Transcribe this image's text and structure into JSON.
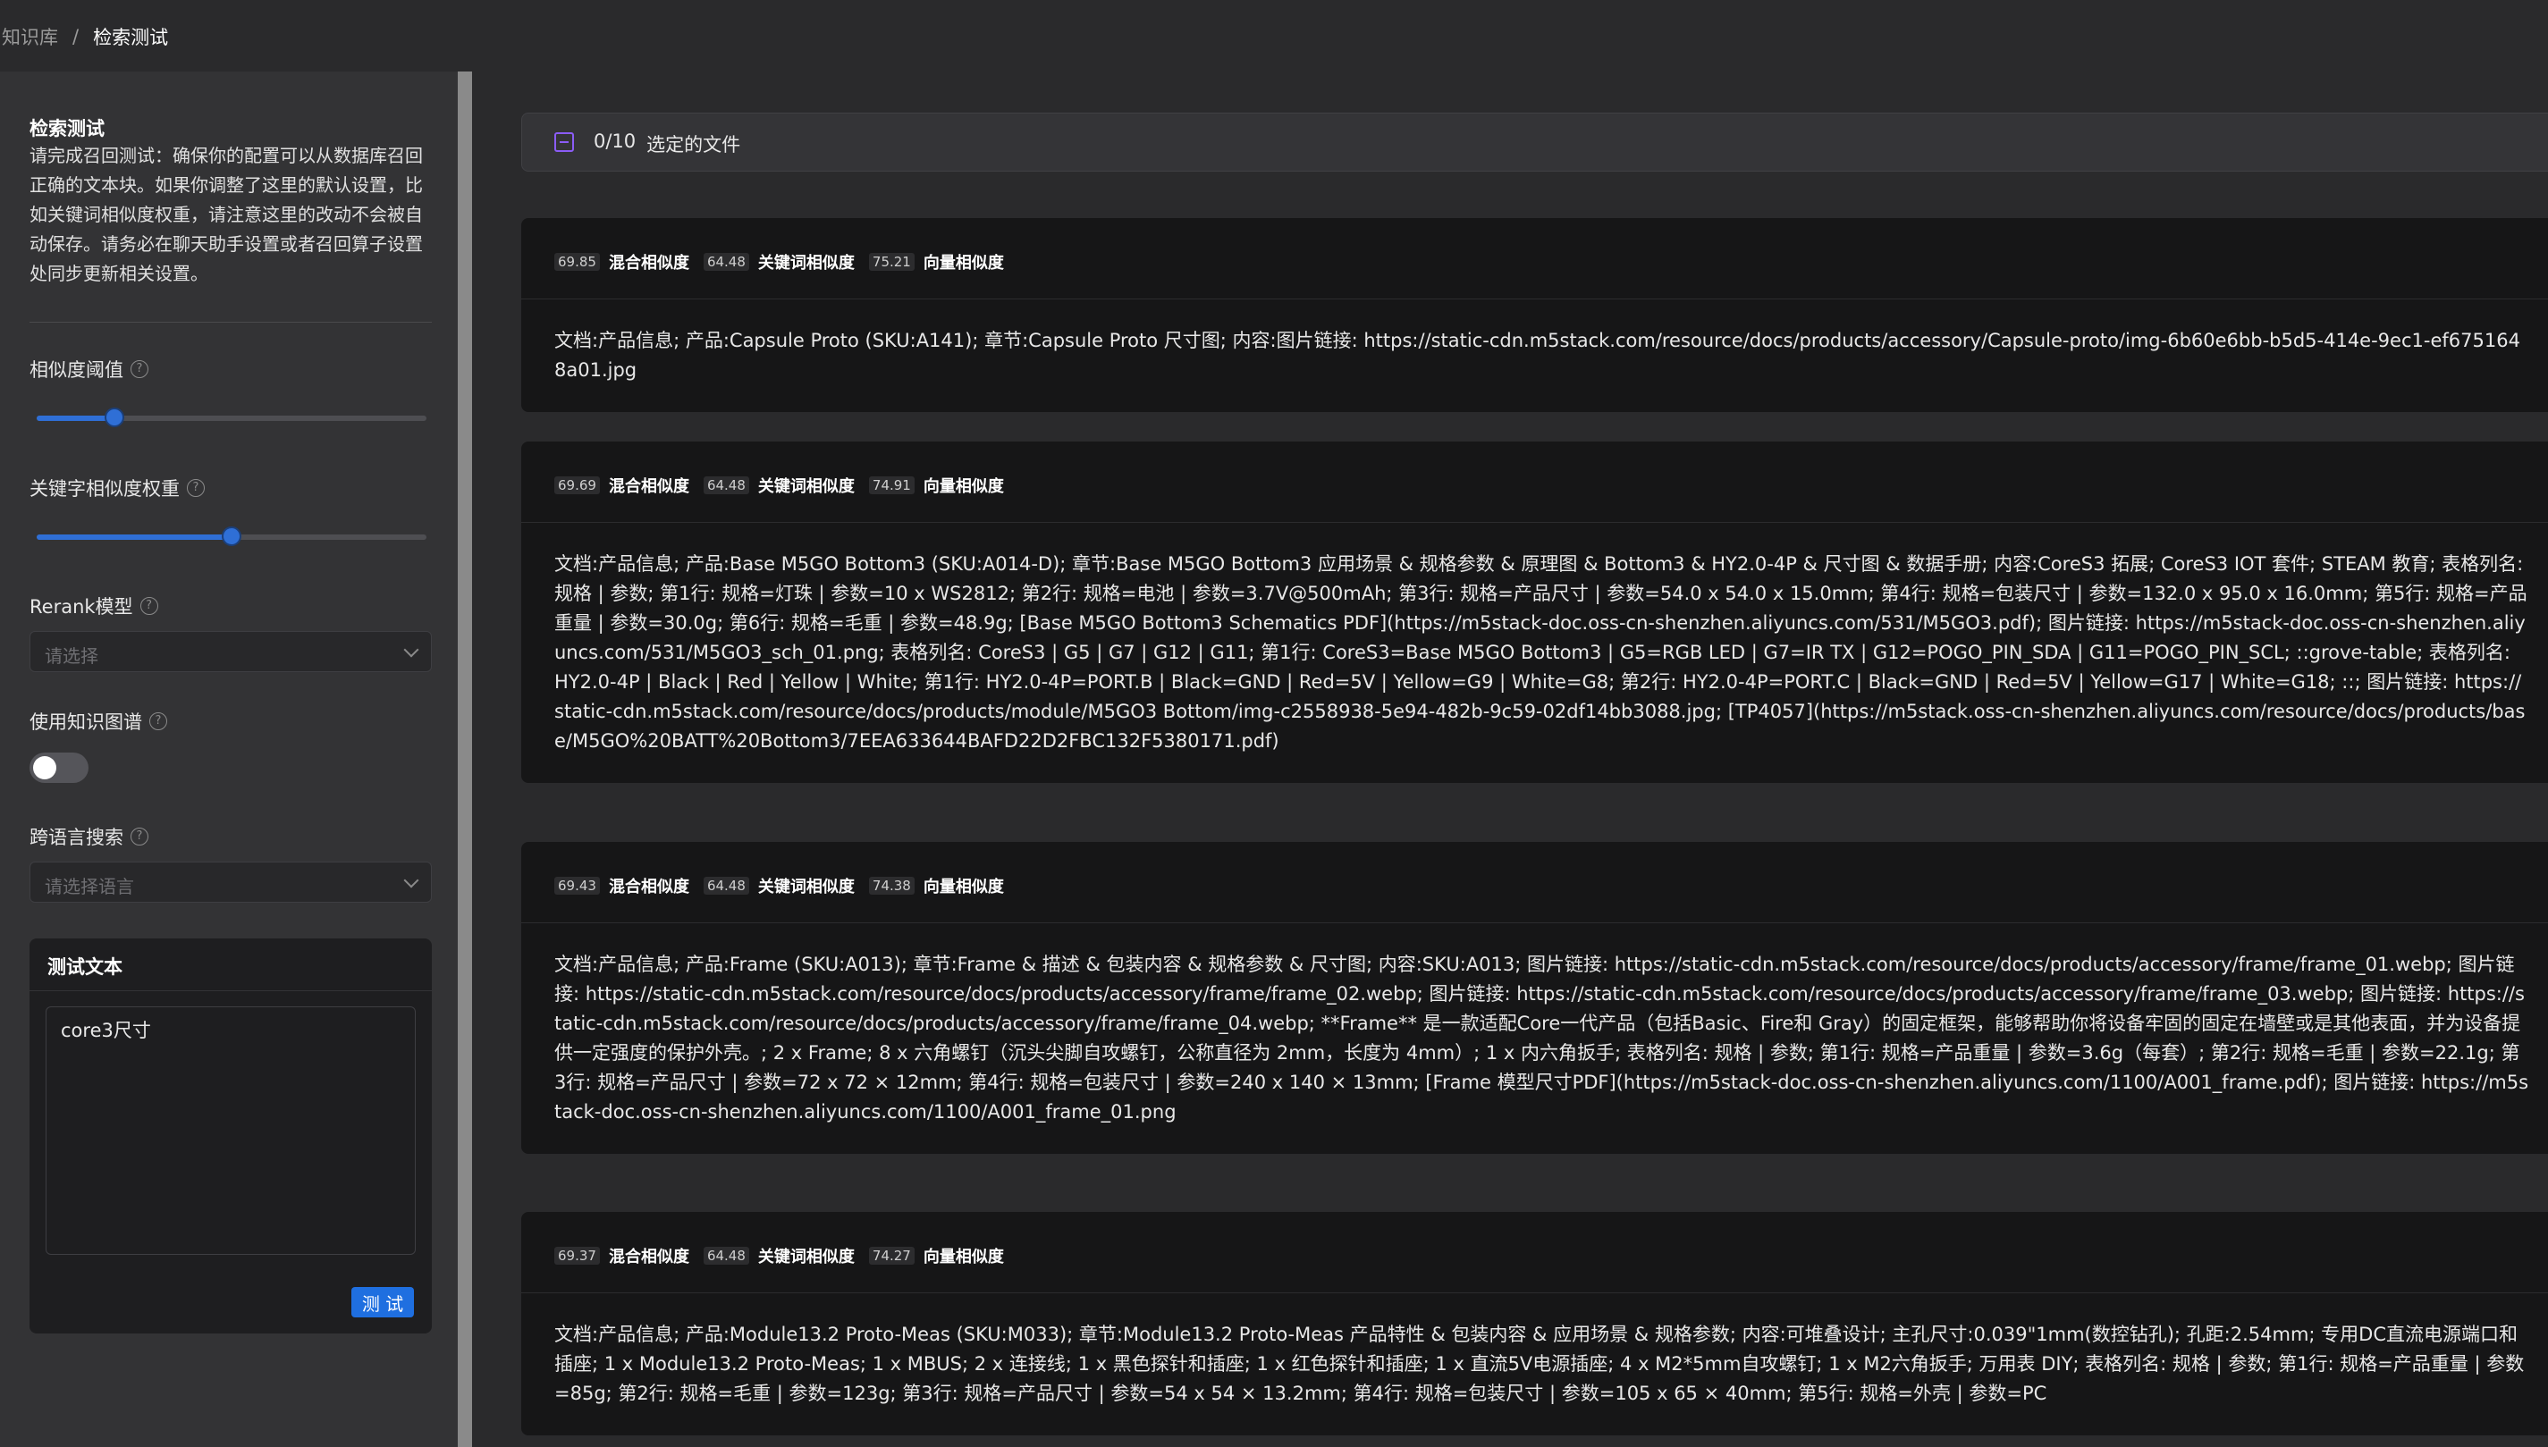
{
  "breadcrumb": {
    "root": "知识库",
    "separator": "/",
    "current": "检索测试"
  },
  "sidebar": {
    "title": "检索测试",
    "description": "请完成召回测试：确保你的配置可以从数据库召回正确的文本块。如果你调整了这里的默认设置，比如关键词相似度权重，请注意这里的改动不会被自动保存。请务必在聊天助手设置或者召回算子设置处同步更新相关设置。",
    "similarity_threshold": {
      "label": "相似度阈值",
      "value": 0.2
    },
    "keyword_weight": {
      "label": "关键字相似度权重",
      "value": 0.5
    },
    "rerank": {
      "label": "Rerank模型",
      "placeholder": "请选择"
    },
    "knowledge_graph": {
      "label": "使用知识图谱",
      "enabled": false
    },
    "cross_language": {
      "label": "跨语言搜索",
      "placeholder": "请选择语言"
    },
    "test_card": {
      "title": "测试文本",
      "input_value": "core3尺寸",
      "button_label": "测 试"
    }
  },
  "file_bar": {
    "count": "0/10",
    "label": "选定的文件"
  },
  "results": [
    {
      "hybrid": "69.85",
      "hybrid_label": "混合相似度",
      "keyword": "64.48",
      "keyword_label": "关键词相似度",
      "vector": "75.21",
      "vector_label": "向量相似度",
      "content": "文档:产品信息; 产品:Capsule Proto (SKU:A141); 章节:Capsule Proto 尺寸图; 内容:图片链接: https://static-cdn.m5stack.com/resource/docs/products/accessory/Capsule-proto/img-6b60e6bb-b5d5-414e-9ec1-ef6751648a01.jpg"
    },
    {
      "hybrid": "69.69",
      "hybrid_label": "混合相似度",
      "keyword": "64.48",
      "keyword_label": "关键词相似度",
      "vector": "74.91",
      "vector_label": "向量相似度",
      "content": "文档:产品信息; 产品:Base M5GO Bottom3 (SKU:A014-D); 章节:Base M5GO Bottom3 应用场景 & 规格参数 & 原理图 & Bottom3 & HY2.0-4P & 尺寸图 & 数据手册; 内容:CoreS3 拓展; CoreS3 IOT 套件; STEAM 教育; 表格列名: 规格 | 参数; 第1行: 规格=灯珠 | 参数=10 x WS2812; 第2行: 规格=电池 | 参数=3.7V@500mAh; 第3行: 规格=产品尺寸 | 参数=54.0 x 54.0 x 15.0mm; 第4行: 规格=包装尺寸 | 参数=132.0 x 95.0 x 16.0mm; 第5行: 规格=产品重量 | 参数=30.0g; 第6行: 规格=毛重 | 参数=48.9g; [Base M5GO Bottom3 Schematics PDF](https://m5stack-doc.oss-cn-shenzhen.aliyuncs.com/531/M5GO3.pdf); 图片链接: https://m5stack-doc.oss-cn-shenzhen.aliyuncs.com/531/M5GO3_sch_01.png; 表格列名: CoreS3 | G5 | G7 | G12 | G11; 第1行: CoreS3=Base M5GO Bottom3 | G5=RGB LED | G7=IR TX | G12=POGO_PIN_SDA | G11=POGO_PIN_SCL; ::grove-table; 表格列名: HY2.0-4P | Black | Red | Yellow | White; 第1行: HY2.0-4P=PORT.B | Black=GND | Red=5V | Yellow=G9 | White=G8; 第2行: HY2.0-4P=PORT.C | Black=GND | Red=5V | Yellow=G17 | White=G18; ::; 图片链接: https://static-cdn.m5stack.com/resource/docs/products/module/M5GO3 Bottom/img-c2558938-5e94-482b-9c59-02df14bb3088.jpg; [TP4057](https://m5stack.oss-cn-shenzhen.aliyuncs.com/resource/docs/products/base/M5GO%20BATT%20Bottom3/7EEA633644BAFD22D2FBC132F5380171.pdf)"
    },
    {
      "hybrid": "69.43",
      "hybrid_label": "混合相似度",
      "keyword": "64.48",
      "keyword_label": "关键词相似度",
      "vector": "74.38",
      "vector_label": "向量相似度",
      "content": "文档:产品信息; 产品:Frame (SKU:A013); 章节:Frame & 描述 & 包装内容 & 规格参数 & 尺寸图; 内容:SKU:A013; 图片链接: https://static-cdn.m5stack.com/resource/docs/products/accessory/frame/frame_01.webp; 图片链接: https://static-cdn.m5stack.com/resource/docs/products/accessory/frame/frame_02.webp; 图片链接: https://static-cdn.m5stack.com/resource/docs/products/accessory/frame/frame_03.webp; 图片链接: https://static-cdn.m5stack.com/resource/docs/products/accessory/frame/frame_04.webp; **Frame** 是一款适配Core一代产品（包括Basic、Fire和 Gray）的固定框架，能够帮助你将设备牢固的固定在墙壁或是其他表面，并为设备提供一定强度的保护外壳。; 2 x Frame; 8 x 六角螺钉（沉头尖脚自攻螺钉，公称直径为 2mm，长度为 4mm）; 1 x 内六角扳手; 表格列名: 规格 | 参数; 第1行: 规格=产品重量 | 参数=3.6g（每套）; 第2行: 规格=毛重 | 参数=22.1g; 第3行: 规格=产品尺寸 | 参数=72 x 72 × 12mm; 第4行: 规格=包装尺寸 | 参数=240 x 140 × 13mm; [Frame 模型尺寸PDF](https://m5stack-doc.oss-cn-shenzhen.aliyuncs.com/1100/A001_frame.pdf); 图片链接: https://m5stack-doc.oss-cn-shenzhen.aliyuncs.com/1100/A001_frame_01.png"
    },
    {
      "hybrid": "69.37",
      "hybrid_label": "混合相似度",
      "keyword": "64.48",
      "keyword_label": "关键词相似度",
      "vector": "74.27",
      "vector_label": "向量相似度",
      "content": "文档:产品信息; 产品:Module13.2 Proto-Meas (SKU:M033); 章节:Module13.2 Proto-Meas 产品特性 & 包装内容 & 应用场景 & 规格参数; 内容:可堆叠设计; 主孔尺寸:0.039\"1mm(数控钻孔); 孔距:2.54mm; 专用DC直流电源端口和插座; 1 x Module13.2 Proto-Meas; 1 x MBUS; 2 x 连接线; 1 x 黑色探针和插座; 1 x 红色探针和插座; 1 x 直流5V电源插座; 4 x M2*5mm自攻螺钉; 1 x M2六角扳手; 万用表 DIY; 表格列名: 规格 | 参数; 第1行: 规格=产品重量 | 参数=85g; 第2行: 规格=毛重 | 参数=123g; 第3行: 规格=产品尺寸 | 参数=54 x 54 × 13.2mm; 第4行: 规格=包装尺寸 | 参数=105 x 65 × 40mm; 第5行: 规格=外壳 | 参数=PC"
    }
  ]
}
